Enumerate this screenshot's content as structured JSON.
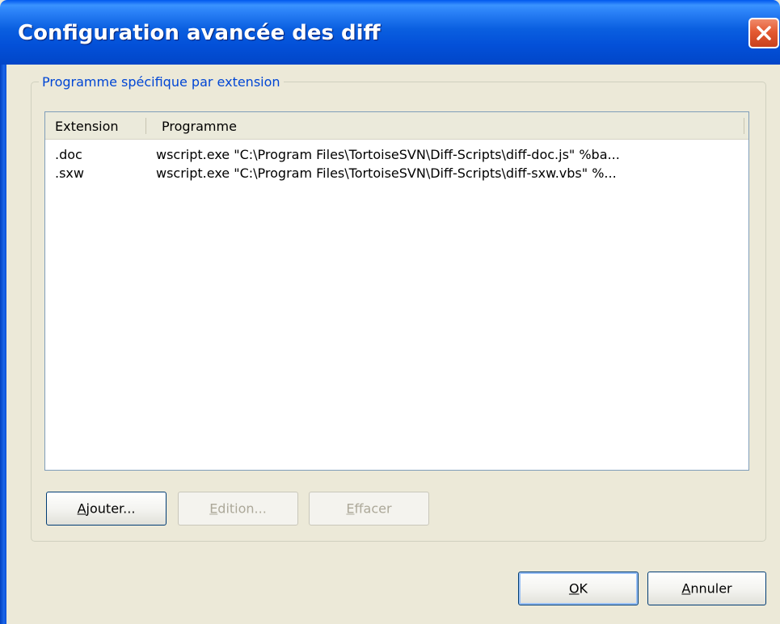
{
  "window": {
    "title": "Configuration avancée des diff"
  },
  "group": {
    "label": "Programme spécifique par extension"
  },
  "list": {
    "columns": [
      {
        "label": "Extension"
      },
      {
        "label": "Programme"
      }
    ],
    "rows": [
      {
        "extension": ".doc",
        "program": "wscript.exe \"C:\\Program Files\\TortoiseSVN\\Diff-Scripts\\diff-doc.js\" %ba..."
      },
      {
        "extension": ".sxw",
        "program": "wscript.exe \"C:\\Program Files\\TortoiseSVN\\Diff-Scripts\\diff-sxw.vbs\" %..."
      }
    ]
  },
  "buttons": {
    "add": {
      "mnemonic": "A",
      "rest": "jouter..."
    },
    "edit": {
      "mnemonic": "E",
      "rest": "dition..."
    },
    "delete": {
      "mnemonic": "E",
      "rest": "ffacer"
    },
    "ok": {
      "mnemonic": "O",
      "rest": "K"
    },
    "cancel": {
      "mnemonic": "A",
      "rest": "nnuler"
    }
  }
}
